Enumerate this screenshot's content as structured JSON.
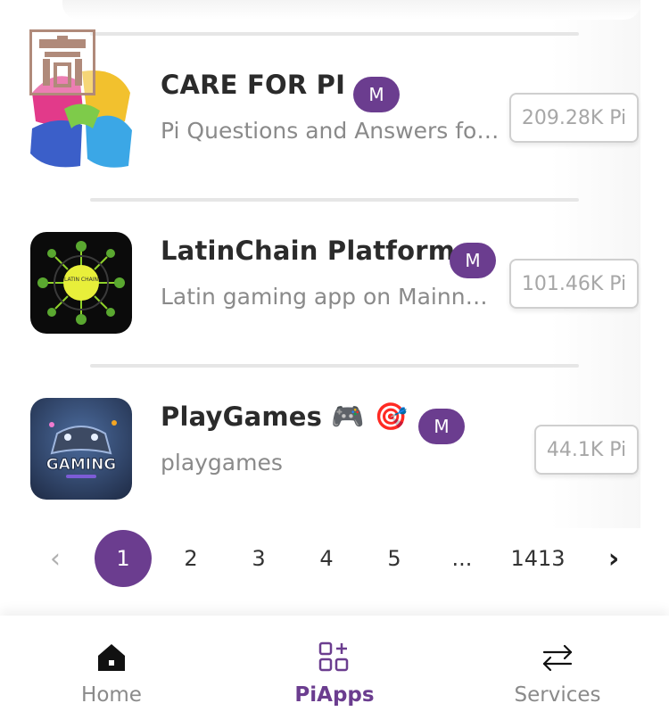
{
  "apps": [
    {
      "name": "CARE FOR PI",
      "badge": "M",
      "description": "Pi Questions and Answers for...",
      "price": "209.28K Pi",
      "icon": "care-for-pi-icon"
    },
    {
      "name": "LatinChain Platform",
      "badge": "M",
      "description": "Latin gaming app on Mainnet...",
      "price": "101.46K Pi",
      "icon": "latinchain-icon",
      "icon_text": "LATIN CHAIN"
    },
    {
      "name": "PlayGames",
      "emoji": "🎮 🎯",
      "badge": "M",
      "description": "playgames",
      "price": "44.1K Pi",
      "icon": "playgames-icon",
      "icon_text": "GAMING"
    }
  ],
  "pagination": {
    "prev": "‹",
    "pages": [
      "1",
      "2",
      "3",
      "4",
      "5",
      "...",
      "1413"
    ],
    "active": "1",
    "next": "›"
  },
  "nav": {
    "items": [
      {
        "label": "Home",
        "icon": "home-icon",
        "active": false
      },
      {
        "label": "PiApps",
        "icon": "apps-grid-icon",
        "active": true
      },
      {
        "label": "Services",
        "icon": "swap-arrows-icon",
        "active": false
      }
    ]
  },
  "colors": {
    "accent": "#6b3d8f",
    "muted_text": "#8a8a8a",
    "divider": "#e6e6e6"
  }
}
